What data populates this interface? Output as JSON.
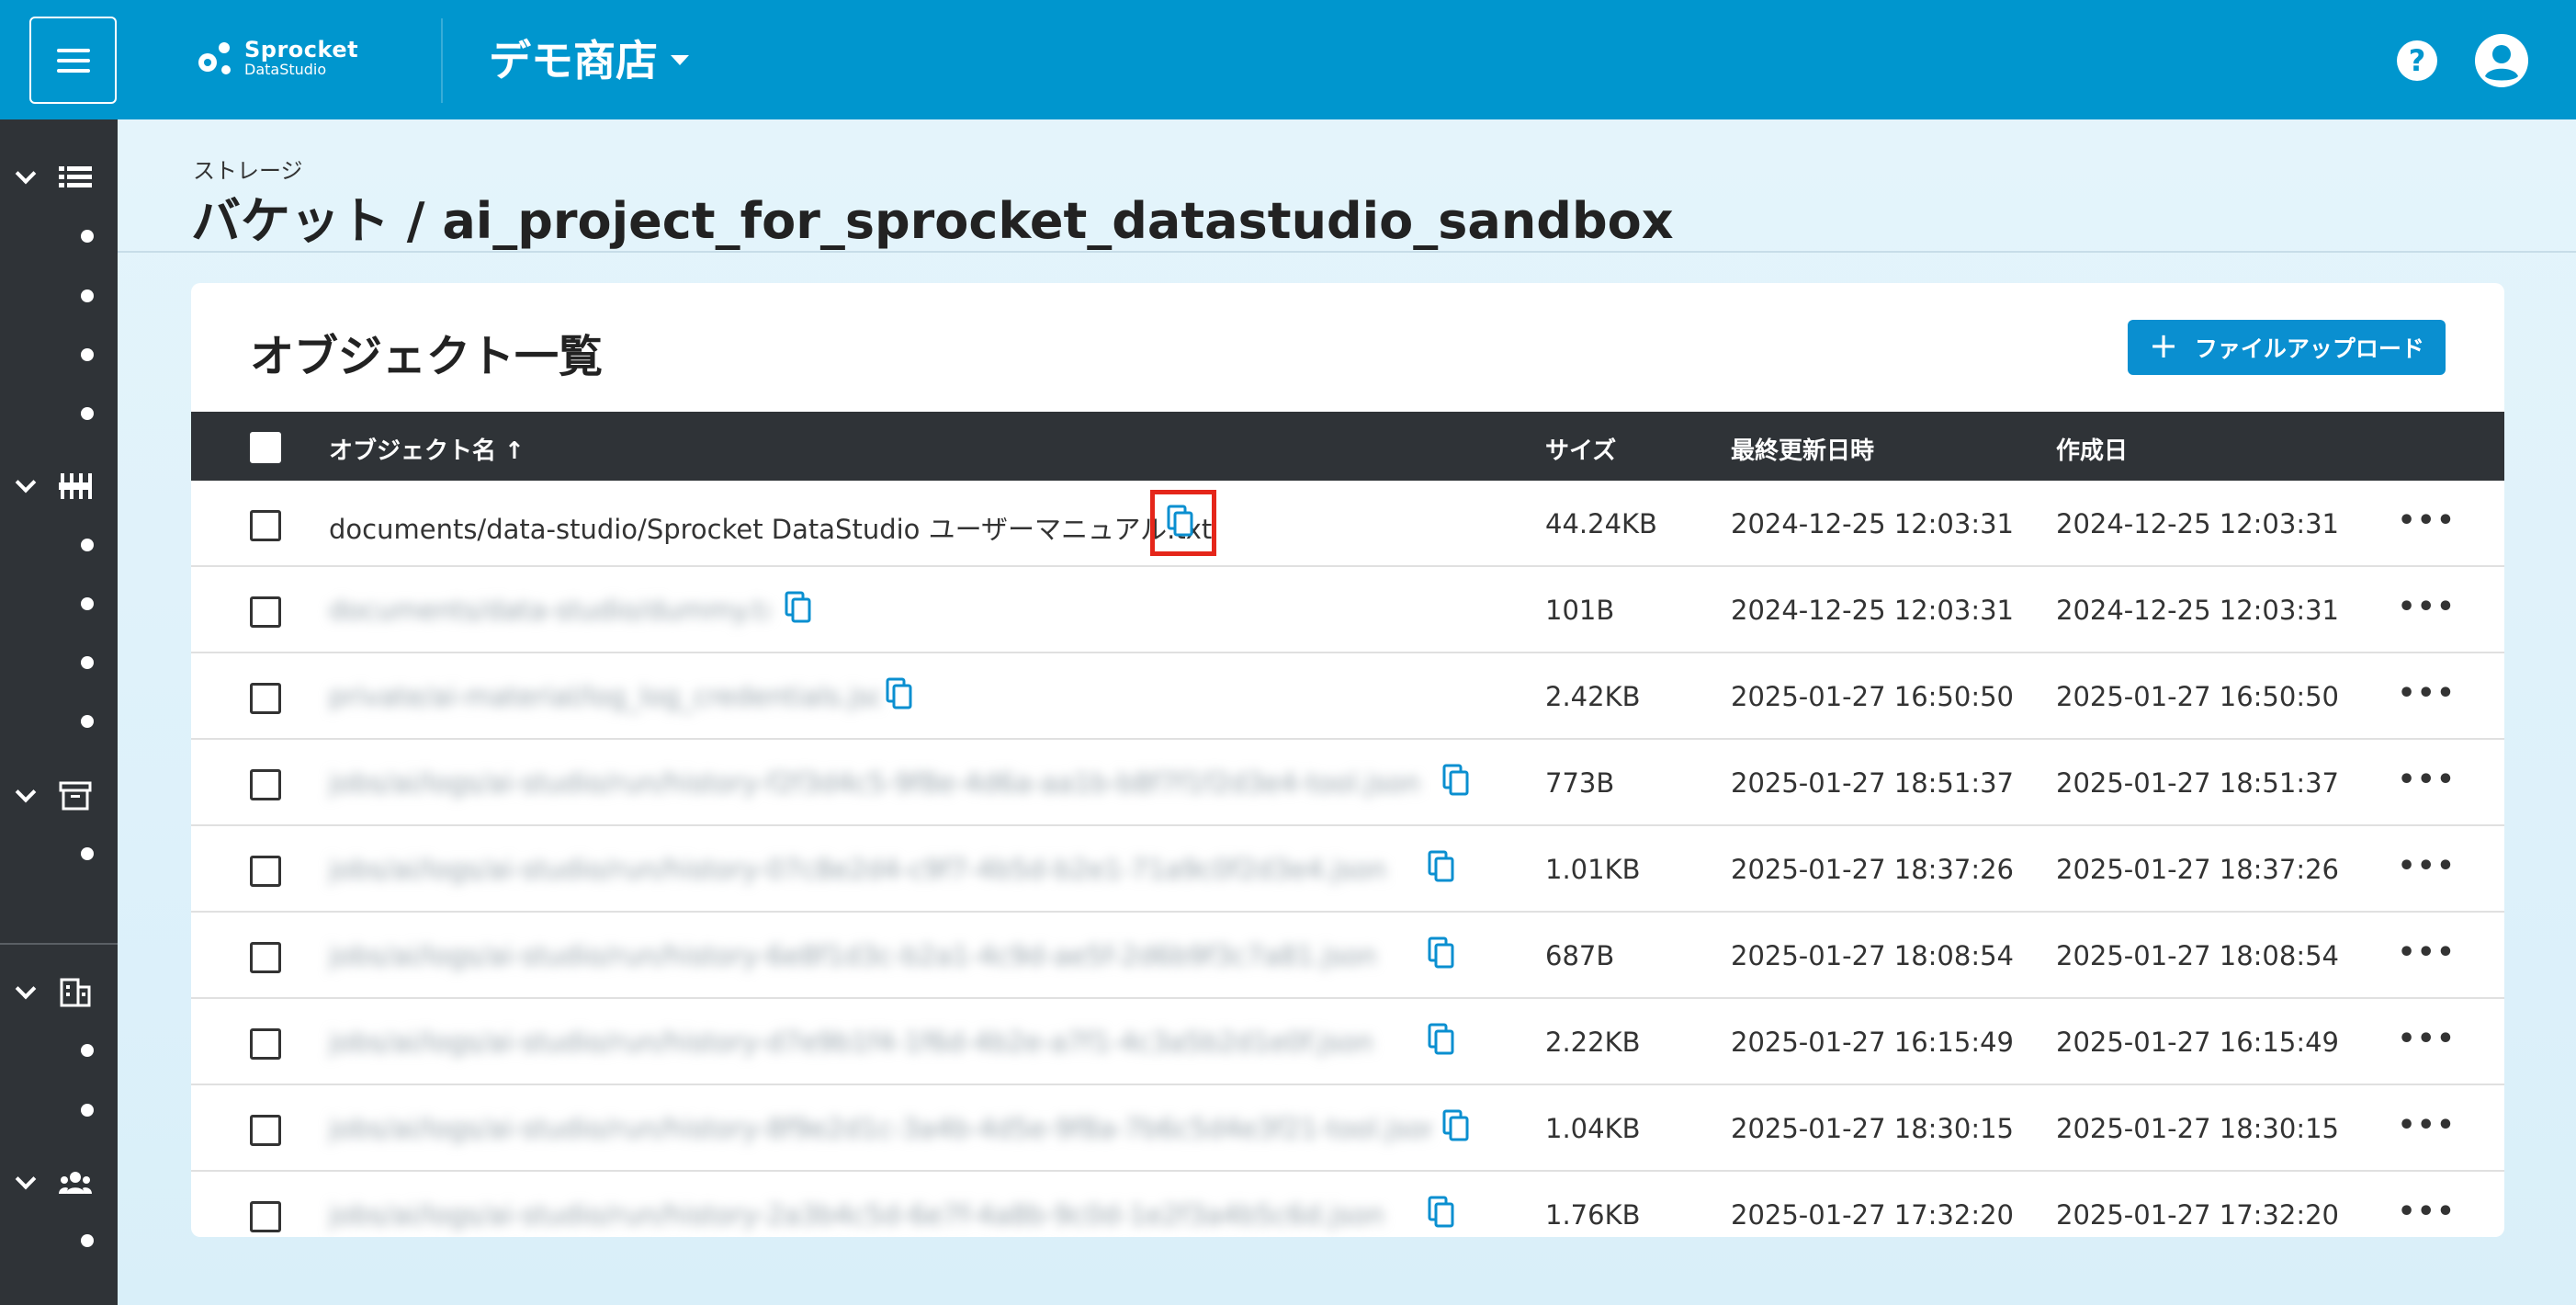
{
  "header": {
    "logo_line1": "Sprocket",
    "logo_line2": "DataStudio",
    "store_name": "デモ商店",
    "help_glyph": "?"
  },
  "breadcrumb": {
    "parent": "ストレージ",
    "title": "バケット / ai_project_for_sprocket_datastudio_sandbox"
  },
  "objects_card": {
    "title": "オブジェクト一覧",
    "upload_label": "ファイルアップロード",
    "upload_plus": "+",
    "columns": {
      "name": "オブジェクト名 ↑",
      "size": "サイズ",
      "updated": "最終更新日時",
      "created": "作成日"
    },
    "rows": [
      {
        "name": "documents/data-studio/Sprocket DataStudio ユーザーマニュアル.txt",
        "size": "44.24KB",
        "updated": "2024-12-25 12:03:31",
        "created": "2024-12-25 12:03:31",
        "more": "•••"
      },
      {
        "name": "documents/data-studio/dummy.txt",
        "size": "101B",
        "updated": "2024-12-25 12:03:31",
        "created": "2024-12-25 12:03:31",
        "more": "•••"
      },
      {
        "name": "private/ai-material/log_log_credentials.json",
        "size": "2.42KB",
        "updated": "2025-01-27 16:50:50",
        "created": "2025-01-27 16:50:50",
        "more": "•••"
      },
      {
        "name": "jobs/ai/logs/ai-studio/run/history-f2f3d4c5-9f8e-4d6a-aa1b-b8f7f1f2d3e4-tool.json",
        "size": "773B",
        "updated": "2025-01-27 18:51:37",
        "created": "2025-01-27 18:51:37",
        "more": "•••"
      },
      {
        "name": "jobs/ai/logs/ai-studio/run/history-07c8e2d4-c9f7-4b5d-b2e1-71a9c0f2d3e4.json",
        "size": "1.01KB",
        "updated": "2025-01-27 18:37:26",
        "created": "2025-01-27 18:37:26",
        "more": "•••"
      },
      {
        "name": "jobs/ai/logs/ai-studio/run/history-6e8f1d3c-b2a1-4c9d-ae5f-2d6b9f3c7a81.json",
        "size": "687B",
        "updated": "2025-01-27 18:08:54",
        "created": "2025-01-27 18:08:54",
        "more": "•••"
      },
      {
        "name": "jobs/ai/logs/ai-studio/run/history-d7e9b1f4-1f6d-4b2e-a7f1-4c3a5b2d1e0f.json",
        "size": "2.22KB",
        "updated": "2025-01-27 16:15:49",
        "created": "2025-01-27 16:15:49",
        "more": "•••"
      },
      {
        "name": "jobs/ai/logs/ai-studio/run/history-8f9e2d1c-3a4b-4d5e-9f8a-7b6c5d4e3f21-tool.json",
        "size": "1.04KB",
        "updated": "2025-01-27 18:30:15",
        "created": "2025-01-27 18:30:15",
        "more": "•••"
      },
      {
        "name": "jobs/ai/logs/ai-studio/run/history-2a3b4c5d-6e7f-4a8b-9c0d-1e2f3a4b5c6d.json",
        "size": "1.76KB",
        "updated": "2025-01-27 17:32:20",
        "created": "2025-01-27 17:32:20",
        "more": "•••"
      }
    ]
  }
}
